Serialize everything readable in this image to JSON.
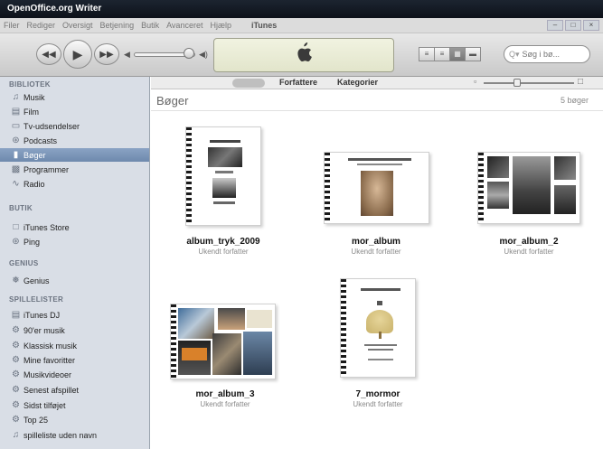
{
  "window": {
    "title": "OpenOffice.org Writer"
  },
  "menu": {
    "items": [
      "Filer",
      "Rediger",
      "Oversigt",
      "Betjening",
      "Butik",
      "Avanceret",
      "Hjælp"
    ],
    "app_title": "iTunes"
  },
  "search": {
    "placeholder": "Søg i bø..."
  },
  "sidebar": {
    "sections": [
      {
        "title": "BIBLIOTEK",
        "items": [
          {
            "label": "Musik",
            "icon": "music-note-icon"
          },
          {
            "label": "Film",
            "icon": "film-icon"
          },
          {
            "label": "Tv-udsendelser",
            "icon": "tv-icon"
          },
          {
            "label": "Podcasts",
            "icon": "podcast-icon"
          },
          {
            "label": "Bøger",
            "icon": "book-icon",
            "selected": true
          },
          {
            "label": "Programmer",
            "icon": "apps-icon"
          },
          {
            "label": "Radio",
            "icon": "radio-icon"
          }
        ]
      },
      {
        "title": "BUTIK",
        "items": [
          {
            "label": "iTunes Store",
            "icon": "store-icon"
          },
          {
            "label": "Ping",
            "icon": "ping-icon"
          }
        ]
      },
      {
        "title": "GENIUS",
        "items": [
          {
            "label": "Genius",
            "icon": "genius-icon"
          }
        ]
      },
      {
        "title": "SPILLELISTER",
        "items": [
          {
            "label": "iTunes DJ",
            "icon": "dj-icon"
          },
          {
            "label": "90'er musik",
            "icon": "smart-playlist-icon"
          },
          {
            "label": "Klassisk musik",
            "icon": "smart-playlist-icon"
          },
          {
            "label": "Mine favoritter",
            "icon": "smart-playlist-icon"
          },
          {
            "label": "Musikvideoer",
            "icon": "smart-playlist-icon"
          },
          {
            "label": "Senest afspillet",
            "icon": "smart-playlist-icon"
          },
          {
            "label": "Sidst tilføjet",
            "icon": "smart-playlist-icon"
          },
          {
            "label": "Top 25",
            "icon": "smart-playlist-icon"
          },
          {
            "label": "spilleliste uden navn",
            "icon": "playlist-icon"
          }
        ]
      }
    ]
  },
  "content": {
    "columns": {
      "author": "Forfattere",
      "category": "Kategorier"
    },
    "title": "Bøger",
    "count": "5 bøger"
  },
  "books": [
    {
      "title": "album_tryk_2009",
      "author": "Ukendt forfatter"
    },
    {
      "title": "mor_album",
      "author": "Ukendt forfatter"
    },
    {
      "title": "mor_album_2",
      "author": "Ukendt forfatter"
    },
    {
      "title": "mor_album_3",
      "author": "Ukendt forfatter"
    },
    {
      "title": "7_mormor",
      "author": "Ukendt forfatter"
    }
  ]
}
